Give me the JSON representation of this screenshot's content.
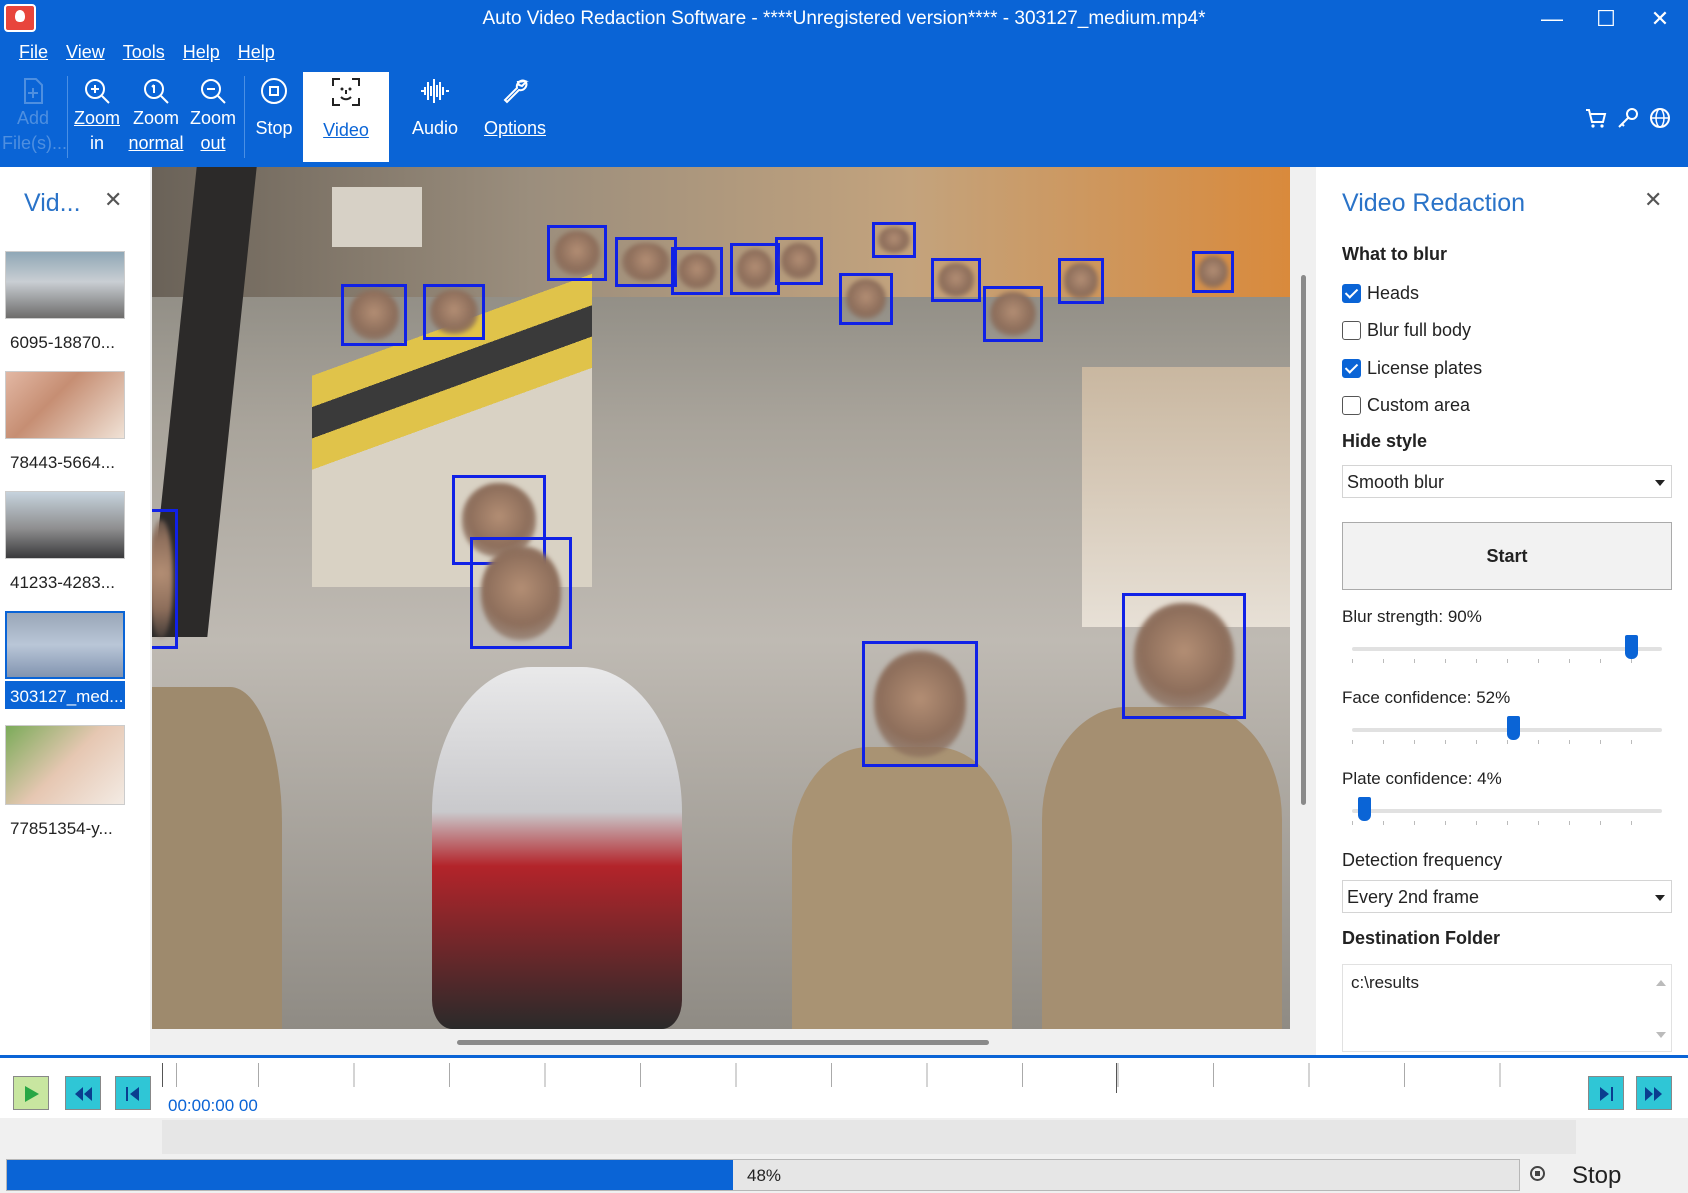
{
  "window": {
    "title": "Auto Video Redaction Software - ****Unregistered version**** - 303127_medium.mp4*",
    "controls": [
      "—",
      "☐",
      "✕"
    ]
  },
  "menu": [
    "File",
    "View",
    "Tools",
    "Help",
    "Help"
  ],
  "toolbar": {
    "add_files": {
      "line1": "Add",
      "line2": "File(s)...",
      "icon": "add-file-icon"
    },
    "zoom_in": {
      "line1": "Zoom",
      "line2": "in",
      "icon": "zoom-in-icon"
    },
    "zoom_normal": {
      "line1": "Zoom",
      "line2": "normal",
      "icon": "zoom-normal-icon"
    },
    "zoom_out": {
      "line1": "Zoom",
      "line2": "out",
      "icon": "zoom-out-icon"
    },
    "stop": {
      "label": "Stop",
      "icon": "stop-icon"
    },
    "video": {
      "label": "Video",
      "icon": "face-scan-icon"
    },
    "audio": {
      "label": "Audio",
      "icon": "waveform-icon"
    },
    "options": {
      "label": "Options",
      "icon": "wrench-icon"
    },
    "right_icons": [
      "cart-icon",
      "key-icon",
      "globe-icon"
    ]
  },
  "left_panel": {
    "title": "Vid...",
    "close": "✕",
    "files": [
      {
        "name": "6095-18870...",
        "selected": false
      },
      {
        "name": "78443-5664...",
        "selected": false
      },
      {
        "name": "41233-4283...",
        "selected": false
      },
      {
        "name": "303127_med...",
        "selected": true
      },
      {
        "name": "77851354-y...",
        "selected": false
      }
    ]
  },
  "right_panel": {
    "title": "Video Redaction",
    "close": "✕",
    "what_to_blur": "What to blur",
    "options": [
      {
        "label": "Heads",
        "checked": true
      },
      {
        "label": "Blur full body",
        "checked": false
      },
      {
        "label": "License plates",
        "checked": true
      },
      {
        "label": "Custom area",
        "checked": false
      }
    ],
    "hide_style_label": "Hide style",
    "hide_style_value": "Smooth blur",
    "start_label": "Start",
    "sliders": [
      {
        "label": "Blur strength: 90%",
        "value": 90
      },
      {
        "label": "Face confidence: 52%",
        "value": 52
      },
      {
        "label": "Plate confidence: 4%",
        "value": 4
      }
    ],
    "detection_frequency_label": "Detection frequency",
    "detection_frequency_value": "Every 2nd frame",
    "destination_label": "Destination Folder",
    "destination_value": "c:\\results"
  },
  "timeline": {
    "timecode": "00:00:00 00"
  },
  "status": {
    "progress_text": "48%",
    "progress_value": 48,
    "stop_label": "Stop"
  }
}
